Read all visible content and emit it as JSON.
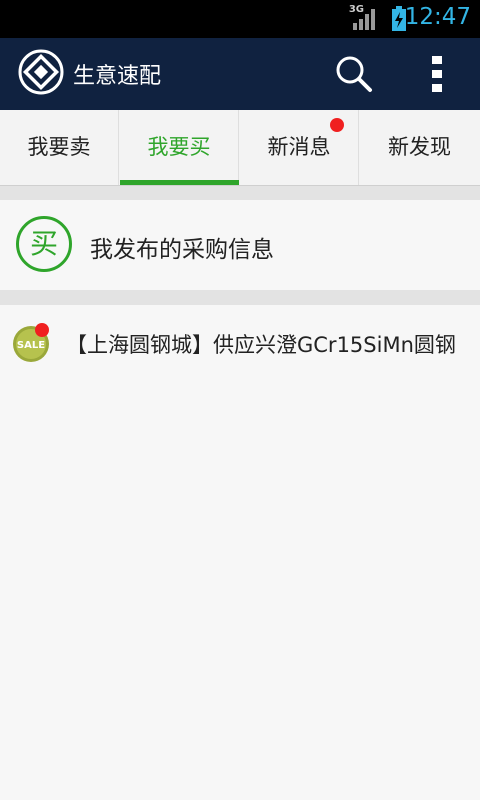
{
  "status_bar": {
    "network": "3G",
    "time": "12:47"
  },
  "app_bar": {
    "title": "生意速配"
  },
  "tabs": [
    {
      "label": "我要卖",
      "active": false,
      "badge": false
    },
    {
      "label": "我要买",
      "active": true,
      "badge": false
    },
    {
      "label": "新消息",
      "active": false,
      "badge": true
    },
    {
      "label": "新发现",
      "active": false,
      "badge": false
    }
  ],
  "section": {
    "icon_char": "买",
    "title": "我发布的采购信息"
  },
  "list": [
    {
      "icon": "sale-icon",
      "sale_text": "SALE",
      "title": "【上海圆钢城】供应兴澄GCr15SiMn圆钢",
      "unread": true
    }
  ],
  "colors": {
    "accent": "#2fa52b",
    "app_bar": "#102240",
    "badge": "#f02020",
    "time": "#33b5e5"
  }
}
